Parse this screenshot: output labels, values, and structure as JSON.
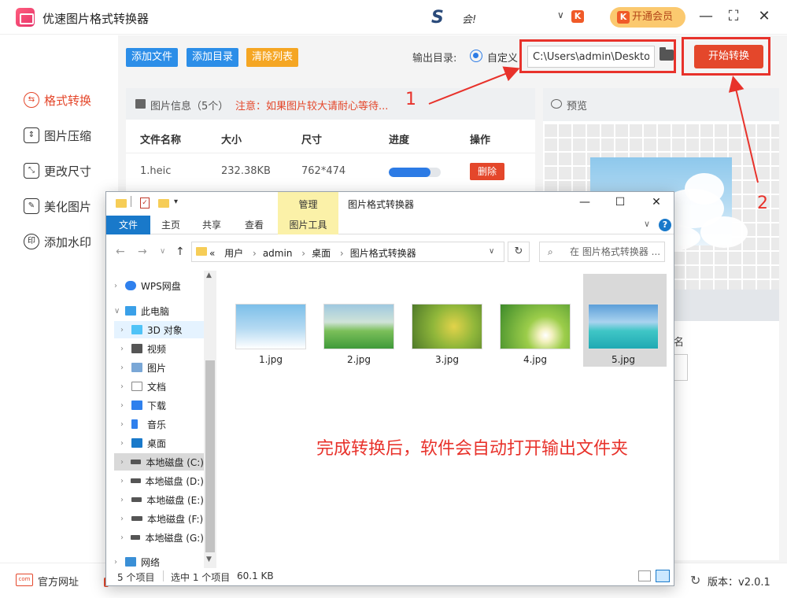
{
  "app": {
    "title": "优速图片格式转换器",
    "user_name": "会!",
    "vip_label": "开通会员",
    "brand_color": "#e4472b"
  },
  "sidebar": {
    "items": [
      {
        "label": "格式转换",
        "icon": "convert-icon",
        "active": true
      },
      {
        "label": "图片压缩",
        "icon": "compress-icon",
        "active": false
      },
      {
        "label": "更改尺寸",
        "icon": "resize-icon",
        "active": false
      },
      {
        "label": "美化图片",
        "icon": "beautify-icon",
        "active": false
      },
      {
        "label": "添加水印",
        "icon": "watermark-icon",
        "active": false
      }
    ]
  },
  "toolbar": {
    "add_file": "添加文件",
    "add_dir": "添加目录",
    "clear_list": "清除列表",
    "output_dir_label": "输出目录:",
    "custom_option": "自定义",
    "output_path": "C:\\Users\\admin\\Desktop",
    "start_button": "开始转换"
  },
  "file_panel": {
    "title": "图片信息（5个）",
    "warning": "注意：如果图片较大请耐心等待...",
    "columns": [
      "文件名称",
      "大小",
      "尺寸",
      "进度",
      "操作"
    ],
    "rows": [
      {
        "name": "1.heic",
        "size": "232.38KB",
        "dimensions": "762*474",
        "progress": 0.8,
        "action": "删除"
      }
    ]
  },
  "preview": {
    "label": "预览",
    "field_label_stub": "名"
  },
  "bottom": {
    "official_site": "官方网址",
    "version": "版本：v2.0.1"
  },
  "annotations": {
    "step1": "1",
    "step2": "2"
  },
  "explorer": {
    "title": "图片格式转换器",
    "manage_tab": "管理",
    "ribbon_tabs": [
      "文件",
      "主页",
      "共享",
      "查看",
      "图片工具"
    ],
    "breadcrumb": [
      "«",
      "用户",
      "admin",
      "桌面",
      "图片格式转换器"
    ],
    "search_placeholder": "在 图片格式转换器 ...",
    "tree": [
      {
        "label": "WPS网盘",
        "icon": "cloud-icon"
      },
      {
        "label": "此电脑",
        "icon": "computer-icon"
      },
      {
        "label": "3D 对象",
        "icon": "cube-icon"
      },
      {
        "label": "视频",
        "icon": "video-icon"
      },
      {
        "label": "图片",
        "icon": "pictures-icon"
      },
      {
        "label": "文档",
        "icon": "documents-icon"
      },
      {
        "label": "下载",
        "icon": "download-icon"
      },
      {
        "label": "音乐",
        "icon": "music-icon"
      },
      {
        "label": "桌面",
        "icon": "desktop-icon"
      },
      {
        "label": "本地磁盘 (C:)",
        "icon": "drive-icon"
      },
      {
        "label": "本地磁盘 (D:)",
        "icon": "drive-icon"
      },
      {
        "label": "本地磁盘 (E:)",
        "icon": "drive-icon"
      },
      {
        "label": "本地磁盘 (F:)",
        "icon": "drive-icon"
      },
      {
        "label": "本地磁盘 (G:)",
        "icon": "drive-icon"
      },
      {
        "label": "网络",
        "icon": "network-icon"
      }
    ],
    "files": [
      {
        "name": "1.jpg"
      },
      {
        "name": "2.jpg"
      },
      {
        "name": "3.jpg"
      },
      {
        "name": "4.jpg"
      },
      {
        "name": "5.jpg",
        "selected": true
      }
    ],
    "message": "完成转换后，软件会自动打开输出文件夹",
    "status": {
      "count": "5 个项目",
      "selected": "选中 1 个项目",
      "size": "60.1 KB"
    }
  }
}
